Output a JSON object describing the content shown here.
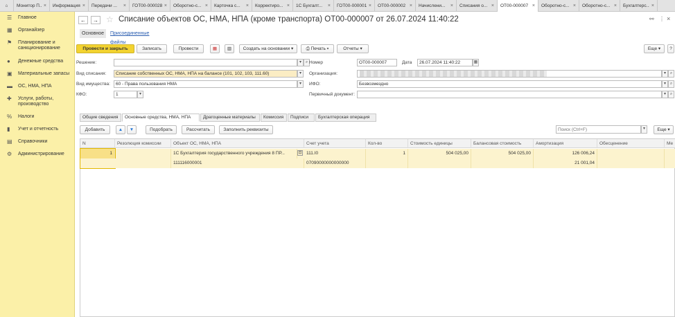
{
  "tabs": [
    {
      "label": "Монитор П..."
    },
    {
      "label": "Информация"
    },
    {
      "label": "Передачи ..."
    },
    {
      "label": "ГОТ00-000028"
    },
    {
      "label": "Оборотно-с..."
    },
    {
      "label": "Карточка с..."
    },
    {
      "label": "Корректиро..."
    },
    {
      "label": "1С Бухгалт..."
    },
    {
      "label": "ГОТ00-000001"
    },
    {
      "label": "ОТ00-000002"
    },
    {
      "label": "Начислени..."
    },
    {
      "label": "Списания о..."
    },
    {
      "label": "ОТ00-000007"
    },
    {
      "label": "Оборотно-с..."
    },
    {
      "label": "Оборотно-с..."
    },
    {
      "label": "Бухгалтерс..."
    }
  ],
  "sidebar": {
    "items": [
      {
        "label": "Главное"
      },
      {
        "label": "Органайзер"
      },
      {
        "label": "Планирование и санкционирование"
      },
      {
        "label": "Денежные средства"
      },
      {
        "label": "Материальные запасы"
      },
      {
        "label": "ОС, НМА, НПА"
      },
      {
        "label": "Услуги, работы, производство"
      },
      {
        "label": "Налоги"
      },
      {
        "label": "Учет и отчетность"
      },
      {
        "label": "Справочники"
      },
      {
        "label": "Администрирование"
      }
    ]
  },
  "document": {
    "title": "Списание объектов ОС, НМА, НПА (кроме транспорта) ОТ00-000007 от 26.07.2024 11:40:22",
    "subtabs": {
      "main": "Основное",
      "files": "Присоединенные файлы"
    }
  },
  "toolbar": {
    "post_close": "Провести и закрыть",
    "save": "Записать",
    "post": "Провести",
    "create_based": "Создать на основании",
    "print": "Печать",
    "reports": "Отчеты",
    "more": "Еще"
  },
  "form": {
    "decision_label": "Решение:",
    "decision_value": "",
    "writeoff_type_label": "Вид списания:",
    "writeoff_type_value": "Списание собственных ОС, НМА, НПА на балансе (101, 102, 103, 111.60)",
    "property_type_label": "Вид имущества:",
    "property_type_value": "60 - Права пользования НМА",
    "kfo_label": "КФО:",
    "kfo_value": "1",
    "number_label": "Номер",
    "number_value": "ОТ00-000007",
    "date_label": "Дата",
    "date_value": "26.07.2024 11:40:22",
    "org_label": "Организация:",
    "ifo_label": "ИФО:",
    "ifo_value": "Безвозмездно",
    "primary_doc_label": "Первичный документ:",
    "primary_doc_value": ""
  },
  "form_tabs": [
    {
      "label": "Общие сведения"
    },
    {
      "label": "Основные средства, НМА, НПА"
    },
    {
      "label": "Драгоценные материалы"
    },
    {
      "label": "Комиссия"
    },
    {
      "label": "Подписи"
    },
    {
      "label": "Бухгалтерская операция"
    }
  ],
  "table_toolbar": {
    "add": "Добавить",
    "select": "Подобрать",
    "calculate": "Рассчитать",
    "fill_requisites": "Заполнить реквизиты",
    "search_placeholder": "Поиск (Ctrl+F)",
    "more": "Еще"
  },
  "table": {
    "columns": [
      "N",
      "Резолюция комиссии",
      "Объект ОС, НМА, НПА",
      "Счет учета",
      "Кол-во",
      "Стоимость единицы",
      "Балансовая стоимость",
      "Амортизация",
      "Обесценение",
      "Ме"
    ],
    "rows": [
      {
        "n": "1",
        "resolution": "",
        "object": "1С Бухгалтерия государственного учреждения 8 ПР...",
        "object_code": "111116000001",
        "account": "111.I0",
        "account_code": "07090000000000000",
        "qty": "1",
        "unit_cost": "504 025,00",
        "book_value": "504 025,00",
        "amortization": "126 006,24",
        "amortization2": "21 001,04"
      }
    ]
  },
  "colors": {
    "accent": "#f3d330",
    "sidebar": "#fbf0a8",
    "row": "#fcf3ce"
  }
}
